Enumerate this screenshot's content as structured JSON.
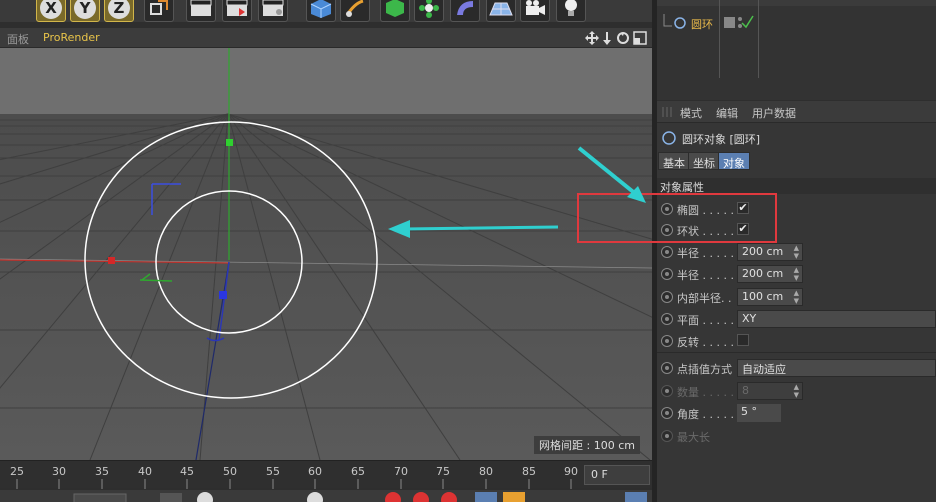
{
  "toolbar": {
    "axis_x": "X",
    "axis_y": "Y",
    "axis_z": "Z"
  },
  "viewport": {
    "menu_panel": "面板",
    "menu_renderer": "ProRender",
    "grid_spacing": "网格间距 : 100 cm"
  },
  "timeline": {
    "ticks": [
      "25",
      "30",
      "35",
      "40",
      "45",
      "50",
      "55",
      "60",
      "65",
      "70",
      "75",
      "80",
      "85",
      "90"
    ],
    "frame": "0 F"
  },
  "object_manager": {
    "object_name": "圆环"
  },
  "attributes": {
    "menu": [
      "模式",
      "编辑",
      "用户数据"
    ],
    "object_title": "圆环对象 [圆环]",
    "tabs": [
      "基本",
      "坐标",
      "对象"
    ],
    "section": "对象属性",
    "params": {
      "ellipse": "椭圆 . . . . .",
      "ring": "环状 . . . . .",
      "radius1": "半径 . . . . .",
      "radius1_value": "200 cm",
      "radius2": "半径 . . . . .",
      "radius2_value": "200 cm",
      "inner_radius": "内部半径. .",
      "inner_radius_value": "100 cm",
      "plane": "平面 . . . . .",
      "plane_value": "XY",
      "reverse": "反转 . . . . .",
      "interp": "点插值方式",
      "interp_value": "自动适应",
      "count": "数量 . . . . .",
      "count_value": "8",
      "angle": "角度 . . . . .",
      "angle_value": "5 °",
      "max_length": "最大长"
    },
    "check_mark": "✔"
  },
  "colors": {
    "accent": "#5b7fb2",
    "arrow": "#2fcfcf",
    "highlight": "#e0393e",
    "object_name": "#e8b84a"
  }
}
